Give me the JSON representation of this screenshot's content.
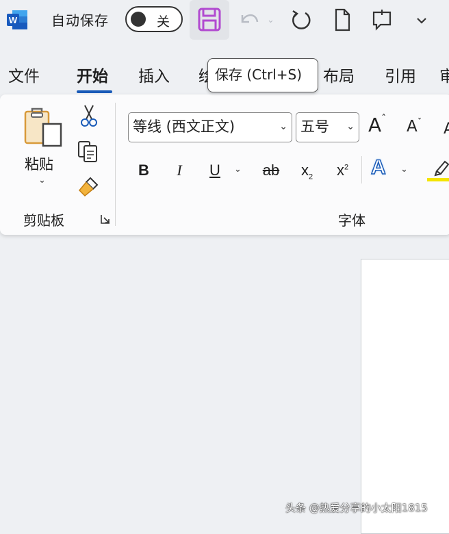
{
  "titlebar": {
    "autosave_label": "自动保存",
    "autosave_state": "关",
    "icons": [
      "word-logo-icon",
      "save-icon",
      "undo-icon",
      "redo-icon",
      "new-document-icon",
      "comment-icon",
      "customize-toolbar-icon"
    ]
  },
  "tooltip": {
    "text": "保存 (Ctrl+S)"
  },
  "tabs": [
    {
      "label": "文件"
    },
    {
      "label": "开始",
      "active": true
    },
    {
      "label": "插入"
    },
    {
      "label": "绘"
    },
    {
      "label": "布局"
    },
    {
      "label": "引用"
    },
    {
      "label": "审"
    }
  ],
  "clipboard": {
    "paste_label": "粘贴",
    "group_label": "剪贴板"
  },
  "font": {
    "font_name": "等线 (西文正文)",
    "font_size": "五号",
    "grow_label": "A",
    "shrink_label": "A",
    "bold": "B",
    "italic": "I",
    "underline": "U",
    "strikethrough": "ab",
    "subscript": "x",
    "subscript_mark": "2",
    "superscript": "x",
    "superscript_mark": "2",
    "text_effects": "A",
    "group_label": "字体"
  },
  "colors": {
    "accent": "#1a5bb8",
    "save_icon": "#b14ad0",
    "highlight": "#f4e400"
  },
  "watermark": "头条 @热爱分享的小太阳1815"
}
